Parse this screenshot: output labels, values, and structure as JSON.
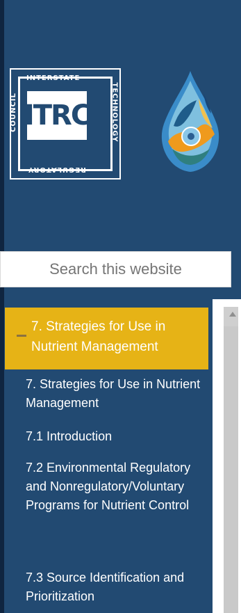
{
  "logo": {
    "top": "INTERSTATE",
    "left": "COUNCIL",
    "right": "TECHNOLOGY",
    "bottom": "REGULATORY",
    "center": "ITRC"
  },
  "search": {
    "placeholder": "Search this website"
  },
  "nav": {
    "current": "7. Strategies for Use in Nutrient Management",
    "items": [
      {
        "label": "7. Strategies for Use in Nutrient Management"
      },
      {
        "label": "7.1 Introduction"
      },
      {
        "label": "7.2 Environmental Regulatory and Nonregulatory/Voluntary Programs for Nutrient Control"
      },
      {
        "label": "7.3 Source Identification and Prioritization"
      }
    ]
  }
}
